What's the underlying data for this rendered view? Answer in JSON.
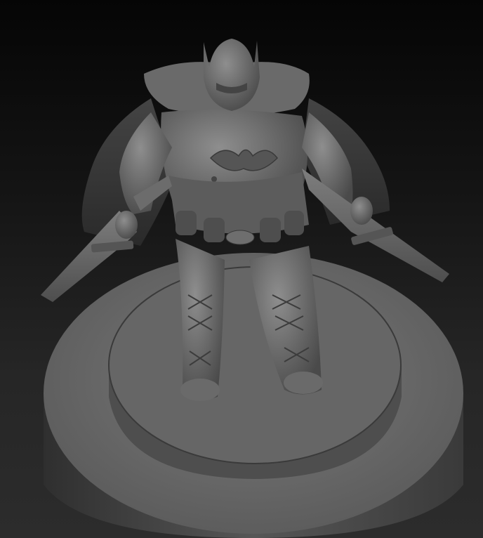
{
  "scene": {
    "subject": "sculpt-render",
    "background_top": "#050505",
    "background_bottom": "#2c2c2c",
    "clay_light": "#8a8a8a",
    "clay_mid": "#5e5e5e",
    "clay_dark": "#2a2a2a"
  }
}
